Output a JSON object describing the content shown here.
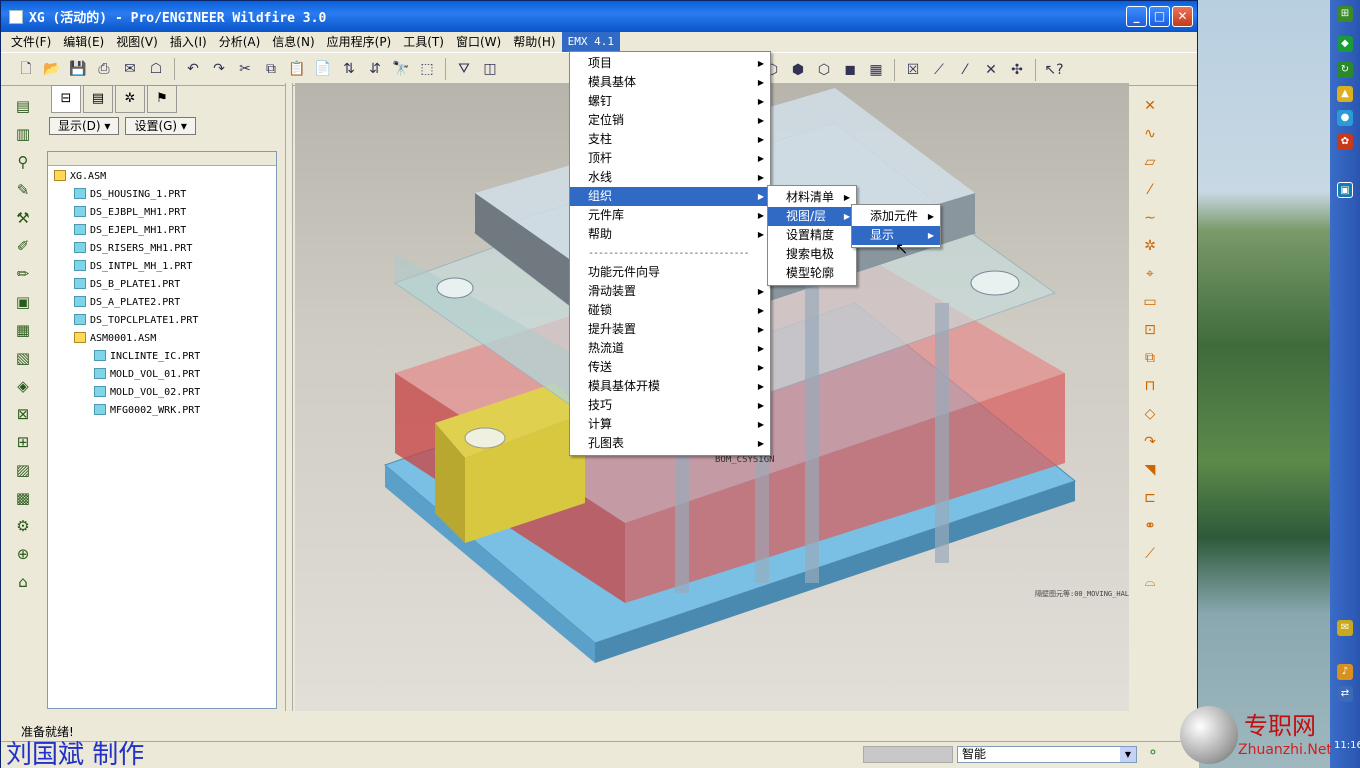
{
  "window": {
    "title": "XG (活动的) - Pro/ENGINEER Wildfire 3.0",
    "minimize": "_",
    "maximize": "□",
    "close": "✕"
  },
  "menubar": [
    "文件(F)",
    "编辑(E)",
    "视图(V)",
    "插入(I)",
    "分析(A)",
    "信息(N)",
    "应用程序(P)",
    "工具(T)",
    "窗口(W)",
    "帮助(H)",
    "EMX 4.1"
  ],
  "tree": {
    "show_btn": "显示(D) ▾",
    "settings_btn": "设置(G) ▾",
    "items": [
      {
        "label": "XG.ASM",
        "level": 0,
        "type": "asm"
      },
      {
        "label": "DS_HOUSING_1.PRT",
        "level": 1,
        "type": "prt"
      },
      {
        "label": "DS_EJBPL_MH1.PRT",
        "level": 1,
        "type": "prt"
      },
      {
        "label": "DS_EJEPL_MH1.PRT",
        "level": 1,
        "type": "prt"
      },
      {
        "label": "DS_RISERS_MH1.PRT",
        "level": 1,
        "type": "prt"
      },
      {
        "label": "DS_INTPL_MH_1.PRT",
        "level": 1,
        "type": "prt"
      },
      {
        "label": "DS_B_PLATE1.PRT",
        "level": 1,
        "type": "prt"
      },
      {
        "label": "DS_A_PLATE2.PRT",
        "level": 1,
        "type": "prt"
      },
      {
        "label": "DS_TOPCLPLATE1.PRT",
        "level": 1,
        "type": "prt"
      },
      {
        "label": "ASM0001.ASM",
        "level": 1,
        "type": "asm"
      },
      {
        "label": "INCLINTE_IC.PRT",
        "level": 2,
        "type": "prt"
      },
      {
        "label": "MOLD_VOL_01.PRT",
        "level": 2,
        "type": "prt"
      },
      {
        "label": "MOLD_VOL_02.PRT",
        "level": 2,
        "type": "prt"
      },
      {
        "label": "MFG0002_WRK.PRT",
        "level": 2,
        "type": "prt"
      }
    ]
  },
  "emx_menu": {
    "items": [
      {
        "label": "项目",
        "arrow": "▶"
      },
      {
        "label": "模具基体",
        "arrow": "▶"
      },
      {
        "label": "螺钉",
        "arrow": "▶"
      },
      {
        "label": "定位销",
        "arrow": "▶"
      },
      {
        "label": "支柱",
        "arrow": "▶"
      },
      {
        "label": "顶杆",
        "arrow": "▶"
      },
      {
        "label": "水线",
        "arrow": "▶"
      },
      {
        "label": "组织",
        "arrow": "▶"
      },
      {
        "label": "元件库",
        "arrow": "▶"
      },
      {
        "label": "帮助",
        "arrow": "▶"
      },
      {
        "label": "--------------------------------",
        "arrow": ""
      },
      {
        "label": "功能元件向导",
        "arrow": ""
      },
      {
        "label": "滑动装置",
        "arrow": "▶"
      },
      {
        "label": "碰锁",
        "arrow": "▶"
      },
      {
        "label": "提升装置",
        "arrow": "▶"
      },
      {
        "label": "热流道",
        "arrow": "▶"
      },
      {
        "label": "传送",
        "arrow": "▶"
      },
      {
        "label": "模具基体开模",
        "arrow": "▶"
      },
      {
        "label": "技巧",
        "arrow": "▶"
      },
      {
        "label": "计算",
        "arrow": "▶"
      },
      {
        "label": "孔图表",
        "arrow": "▶"
      }
    ],
    "selected_index": 7
  },
  "org_menu": {
    "items": [
      {
        "label": "材料清单",
        "arrow": "▶"
      },
      {
        "label": "视图/层",
        "arrow": "▶"
      },
      {
        "label": "设置精度",
        "arrow": ""
      },
      {
        "label": "搜索电极",
        "arrow": ""
      },
      {
        "label": "模型轮廓",
        "arrow": ""
      }
    ],
    "selected_index": 1
  },
  "view_menu": {
    "items": [
      {
        "label": "添加元件",
        "arrow": "▶"
      },
      {
        "label": "显示",
        "arrow": "▶"
      }
    ],
    "selected_index": 1
  },
  "graphics": {
    "coord_label": "BOM_CSYSIGN",
    "layer_label": "隔壁图元等:00_MOVING_HAL"
  },
  "status": {
    "message": "准备就绪!",
    "filter_value": "智能"
  },
  "credit": "刘国斌 制作",
  "watermark": {
    "cn": "专职网",
    "en": "Zhuanzhi.Net"
  },
  "clock": "11:16",
  "colors": {
    "titlebar": "#0a5fd8",
    "menu_highlight": "#316ac5",
    "red_plate": "#d05050",
    "blue_base": "#6ab8e0",
    "yellow_insert": "#d8c840"
  }
}
